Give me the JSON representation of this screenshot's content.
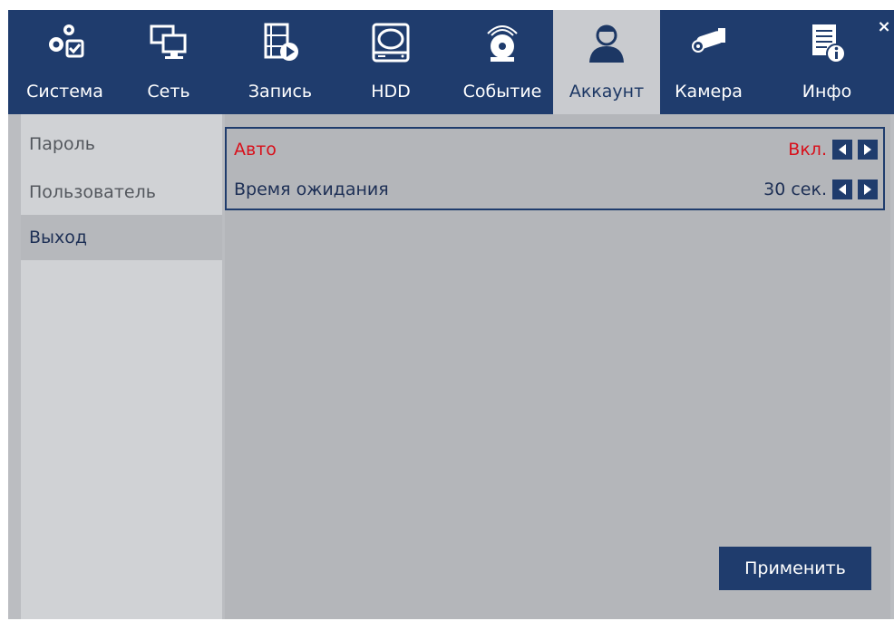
{
  "window": {
    "close_symbol": "×"
  },
  "tabs": [
    {
      "label": "Система",
      "icon": "system-gear-icon",
      "active": false
    },
    {
      "label": "Сеть",
      "icon": "network-icon",
      "active": false
    },
    {
      "label": "Запись",
      "icon": "record-icon",
      "active": false
    },
    {
      "label": "HDD",
      "icon": "hdd-icon",
      "active": false
    },
    {
      "label": "Событие",
      "icon": "event-alarm-icon",
      "active": false
    },
    {
      "label": "Аккаунт",
      "icon": "account-user-icon",
      "active": true
    },
    {
      "label": "Камера",
      "icon": "camera-icon",
      "active": false
    },
    {
      "label": "Инфо",
      "icon": "info-icon",
      "active": false
    }
  ],
  "sidebar": {
    "items": [
      {
        "label": "Пароль",
        "active": false
      },
      {
        "label": "Пользователь",
        "active": false
      },
      {
        "label": "Выход",
        "active": true
      }
    ]
  },
  "settings": {
    "rows": [
      {
        "label": "Авто",
        "value": "Вкл.",
        "highlight": true
      },
      {
        "label": "Время ожидания",
        "value": "30 сек.",
        "highlight": false
      }
    ]
  },
  "apply_label": "Применить",
  "colors": {
    "header_bg": "#1f3c6d",
    "active_tab_bg": "#c9cbcf",
    "panel_bg": "#b4b6ba",
    "highlight_text": "#d8101b"
  }
}
